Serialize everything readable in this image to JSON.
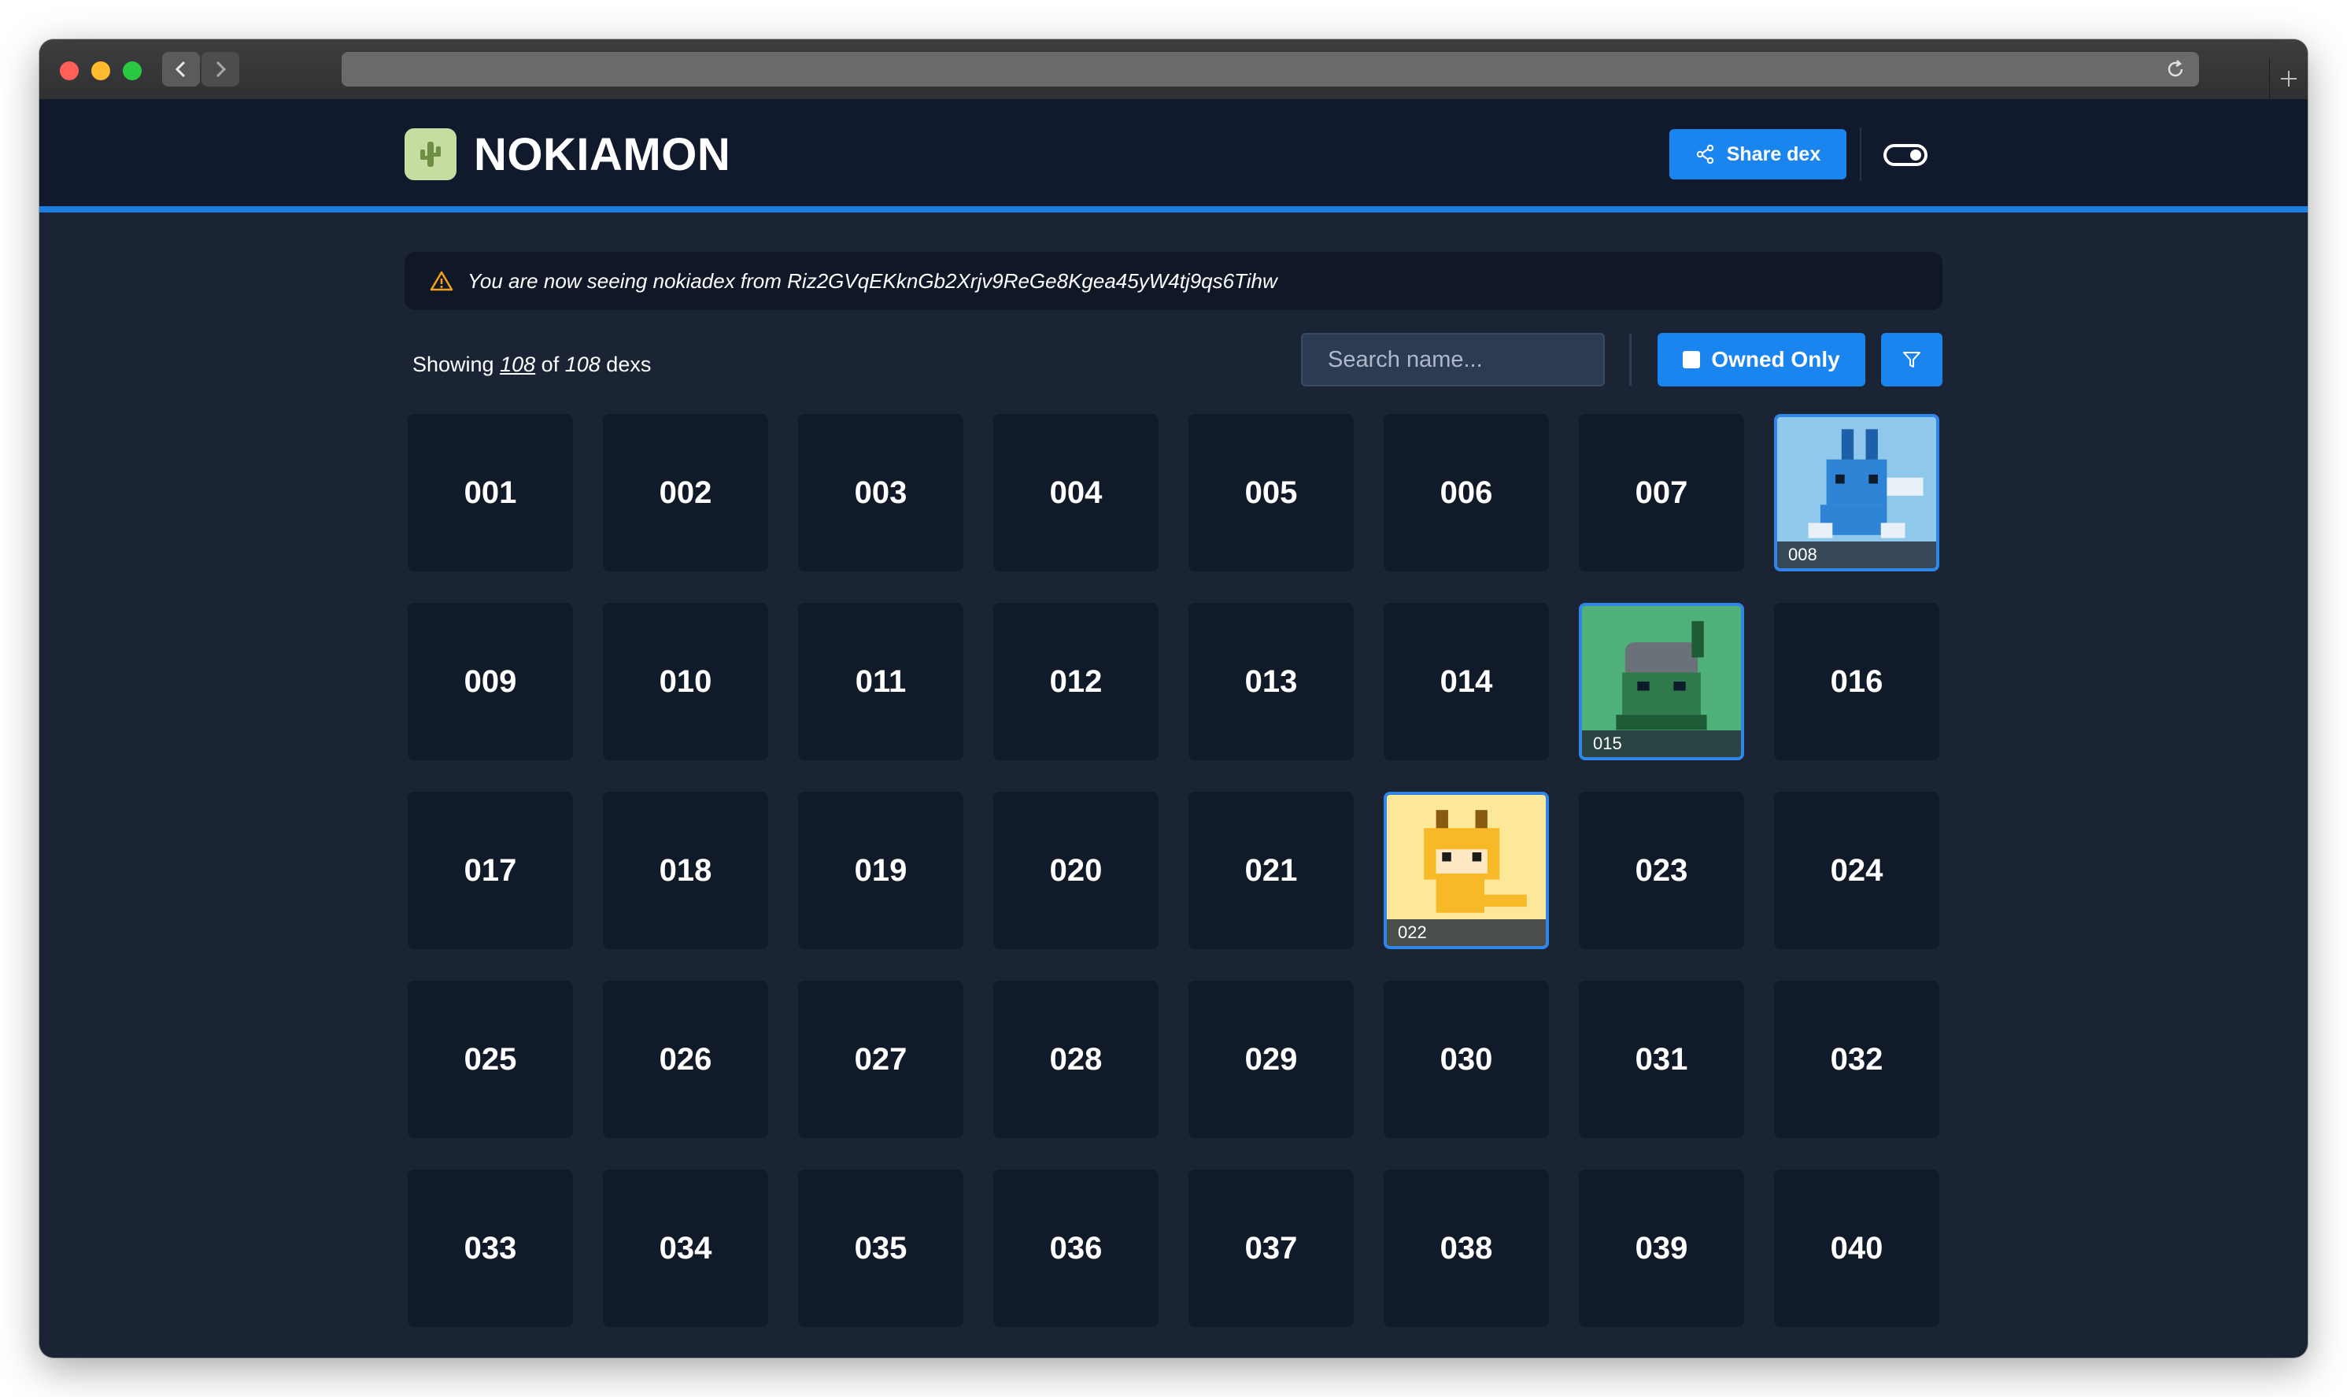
{
  "app": {
    "name": "NOKIAMON"
  },
  "header": {
    "share_label": "Share dex"
  },
  "notice": {
    "text": "You are now seeing nokiadex from Riz2GVqEKknGb2Xrjv9ReGe8Kgea45yW4tj9qs6Tihw"
  },
  "summary": {
    "prefix": "Showing",
    "shown": "108",
    "of": "of",
    "total": "108",
    "suffix": "dexs"
  },
  "search": {
    "placeholder": "Search name..."
  },
  "filters": {
    "owned_only_label": "Owned Only"
  },
  "colors": {
    "accent": "#1a84ef",
    "background": "#1a2435",
    "card": "#111a29"
  },
  "cards": [
    {
      "number": "001",
      "owned": false
    },
    {
      "number": "002",
      "owned": false
    },
    {
      "number": "003",
      "owned": false
    },
    {
      "number": "004",
      "owned": false
    },
    {
      "number": "005",
      "owned": false
    },
    {
      "number": "006",
      "owned": false
    },
    {
      "number": "007",
      "owned": false
    },
    {
      "number": "008",
      "owned": true,
      "bg": "#8fc8ea",
      "icon": "blue-bug-creature-icon"
    },
    {
      "number": "009",
      "owned": false
    },
    {
      "number": "010",
      "owned": false
    },
    {
      "number": "011",
      "owned": false
    },
    {
      "number": "012",
      "owned": false
    },
    {
      "number": "013",
      "owned": false
    },
    {
      "number": "014",
      "owned": false
    },
    {
      "number": "015",
      "owned": true,
      "bg": "#4fb07a",
      "icon": "helmet-frog-creature-icon"
    },
    {
      "number": "016",
      "owned": false
    },
    {
      "number": "017",
      "owned": false
    },
    {
      "number": "018",
      "owned": false
    },
    {
      "number": "019",
      "owned": false
    },
    {
      "number": "020",
      "owned": false
    },
    {
      "number": "021",
      "owned": false
    },
    {
      "number": "022",
      "owned": true,
      "bg": "#fde89a",
      "icon": "yellow-monkey-creature-icon"
    },
    {
      "number": "023",
      "owned": false
    },
    {
      "number": "024",
      "owned": false
    },
    {
      "number": "025",
      "owned": false
    },
    {
      "number": "026",
      "owned": false
    },
    {
      "number": "027",
      "owned": false
    },
    {
      "number": "028",
      "owned": false
    },
    {
      "number": "029",
      "owned": false
    },
    {
      "number": "030",
      "owned": false
    },
    {
      "number": "031",
      "owned": false
    },
    {
      "number": "032",
      "owned": false
    },
    {
      "number": "033",
      "owned": false
    },
    {
      "number": "034",
      "owned": false
    },
    {
      "number": "035",
      "owned": false
    },
    {
      "number": "036",
      "owned": false
    },
    {
      "number": "037",
      "owned": false
    },
    {
      "number": "038",
      "owned": false
    },
    {
      "number": "039",
      "owned": false
    },
    {
      "number": "040",
      "owned": false
    }
  ]
}
